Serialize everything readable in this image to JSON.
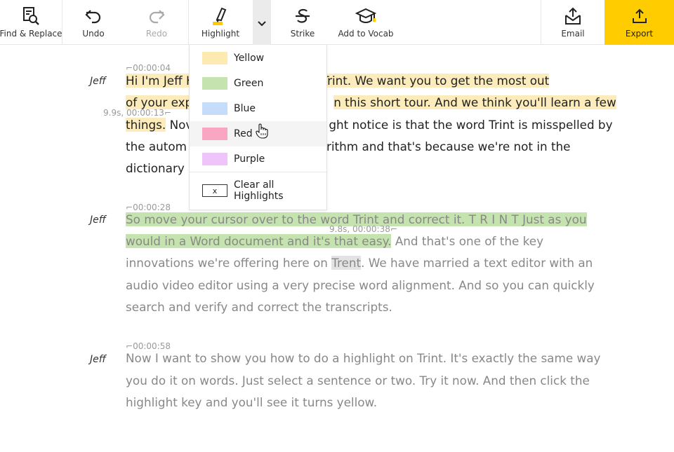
{
  "toolbar": {
    "find_replace": "Find & Replace",
    "undo": "Undo",
    "redo": "Redo",
    "highlight": "Highlight",
    "strike": "Strike",
    "add_to_vocab": "Add to Vocab",
    "email": "Email",
    "export": "Export",
    "export_color": "#ffcc00"
  },
  "highlight_menu": {
    "items": [
      {
        "label": "Yellow",
        "color": "#fdeab0"
      },
      {
        "label": "Green",
        "color": "#c5e3ae"
      },
      {
        "label": "Blue",
        "color": "#c6dcfb"
      },
      {
        "label": "Red",
        "color": "#f9a6c2"
      },
      {
        "label": "Purple",
        "color": "#efc4fa"
      }
    ],
    "clear_box": "x",
    "clear_label": "Clear all Highlights",
    "hovered": "Red"
  },
  "transcript": {
    "blocks": [
      {
        "speaker": "Jeff",
        "timestamp": "00:00:04",
        "inline_time": "9.9s, 00:00:13",
        "lines": [
          [
            "Hi I'm Jeff K",
            "ounder of Trint. We want you to get the most out"
          ],
          [
            "of your exp",
            "n this short tour. And we think you'll learn a few"
          ],
          [
            "things.",
            " Nov",
            "ght notice is that the word Trint is misspelled by"
          ],
          [
            "the autom",
            "rithm and that's because we're not in the"
          ],
          [
            "dictionary"
          ]
        ]
      },
      {
        "speaker": "Jeff",
        "timestamp": "00:00:28",
        "inline_time": "9.8s, 00:00:38",
        "lines": [
          [
            "So move your cursor over to the word Trint and correct it. T R I N T Just as you"
          ],
          [
            "would in a Word document and it's that easy.",
            " And that's one of the key"
          ],
          [
            "innovations we're offering here on ",
            "Trent",
            ". We have married a text editor with an"
          ],
          [
            "audio video editor using a very precise word alignment. And so you can quickly"
          ],
          [
            "search and verify and correct the transcripts."
          ]
        ]
      },
      {
        "speaker": "Jeff",
        "timestamp": "00:00:58",
        "lines": [
          [
            "Now I want to show you how to do a highlight on Trint. It's exactly the same way"
          ],
          [
            "you do it on words. Just select a sentence or two. Try it now. And then click the"
          ],
          [
            "highlight key and you'll see it turns yellow."
          ]
        ]
      }
    ]
  }
}
